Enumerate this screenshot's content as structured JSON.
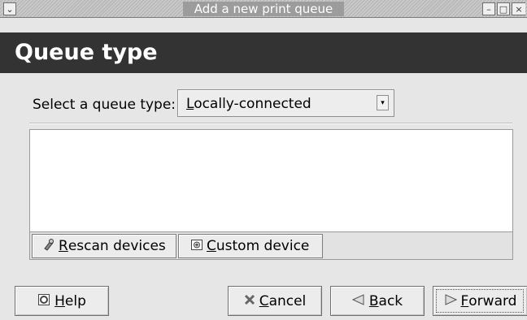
{
  "window": {
    "title": "Add a new print queue",
    "controls": {
      "menu": "⌄",
      "minimize": "–",
      "maximize": "□",
      "close": "×"
    }
  },
  "header": {
    "title": "Queue type"
  },
  "queue": {
    "label": "Select a queue type:",
    "selected_first": "L",
    "selected_rest": "ocally-connected",
    "arrow": "▾"
  },
  "device_toolbar": {
    "rescan": {
      "icon": "rescan-icon",
      "first": "R",
      "rest": "escan devices"
    },
    "custom": {
      "icon": "custom-device-icon",
      "first": "C",
      "rest": "ustom device"
    }
  },
  "buttons": {
    "help": {
      "icon": "help-icon",
      "first": "H",
      "rest": "elp"
    },
    "cancel": {
      "icon": "cancel-icon",
      "first": "C",
      "rest": "ancel"
    },
    "back": {
      "icon": "back-arrow-icon",
      "first": "B",
      "rest": "ack"
    },
    "forward": {
      "icon": "forward-arrow-icon",
      "first": "F",
      "rest": "orward"
    }
  }
}
